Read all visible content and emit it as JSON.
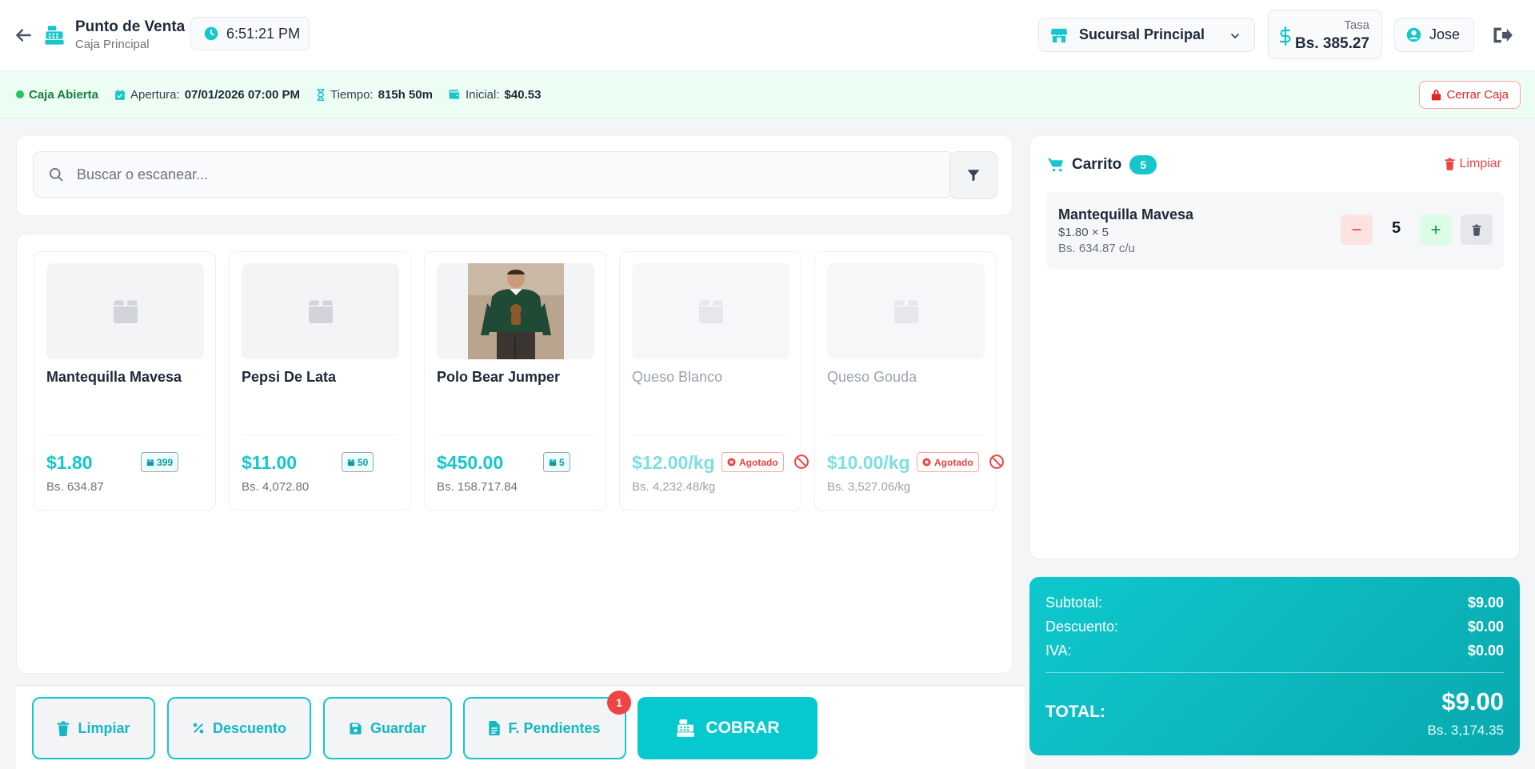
{
  "header": {
    "title": "Punto de Venta",
    "subtitle": "Caja Principal",
    "clock": "6:51:21 PM",
    "branch": "Sucursal Principal",
    "rate_label": "Tasa",
    "rate_value": "Bs. 385.27",
    "user": "Jose"
  },
  "status": {
    "state": "Caja Abierta",
    "opening_label": "Apertura:",
    "opening_value": "07/01/2026 07:00 PM",
    "time_label": "Tiempo:",
    "time_value": "815h 50m",
    "initial_label": "Inicial:",
    "initial_value": "$40.53",
    "close_button": "Cerrar Caja"
  },
  "search": {
    "placeholder": "Buscar o escanear..."
  },
  "products": [
    {
      "name": "Mantequilla Mavesa",
      "price": "$1.80",
      "bs": "Bs. 634.87",
      "stock": "399"
    },
    {
      "name": "Pepsi De Lata",
      "price": "$11.00",
      "bs": "Bs. 4,072.80",
      "stock": "50"
    },
    {
      "name": "Polo Bear Jumper",
      "price": "$450.00",
      "bs": "Bs. 158.717.84",
      "stock": "5"
    },
    {
      "name": "Queso Blanco",
      "price": "$12.00/kg",
      "bs": "Bs. 4,232.48/kg",
      "status": "Agotado"
    },
    {
      "name": "Queso Gouda",
      "price": "$10.00/kg",
      "bs": "Bs. 3,527.06/kg",
      "status": "Agotado"
    }
  ],
  "actions": {
    "clear": "Limpiar",
    "discount": "Descuento",
    "save": "Guardar",
    "pending": "F. Pendientes",
    "pending_count": "1",
    "charge": "COBRAR"
  },
  "cart": {
    "title": "Carrito",
    "count": "5",
    "clear": "Limpiar",
    "items": [
      {
        "name": "Mantequilla Mavesa",
        "line": "$1.80 × 5",
        "unit": "Bs. 634.87 c/u",
        "qty": "5"
      }
    ]
  },
  "totals": {
    "subtotal_label": "Subtotal:",
    "subtotal": "$9.00",
    "discount_label": "Descuento:",
    "discount": "$0.00",
    "tax_label": "IVA:",
    "tax": "$0.00",
    "total_label": "TOTAL:",
    "total": "$9.00",
    "total_bs": "Bs. 3,174.35"
  },
  "colors": {
    "accent": "#14c7cc",
    "danger": "#ef4444",
    "success": "#22c55e"
  }
}
